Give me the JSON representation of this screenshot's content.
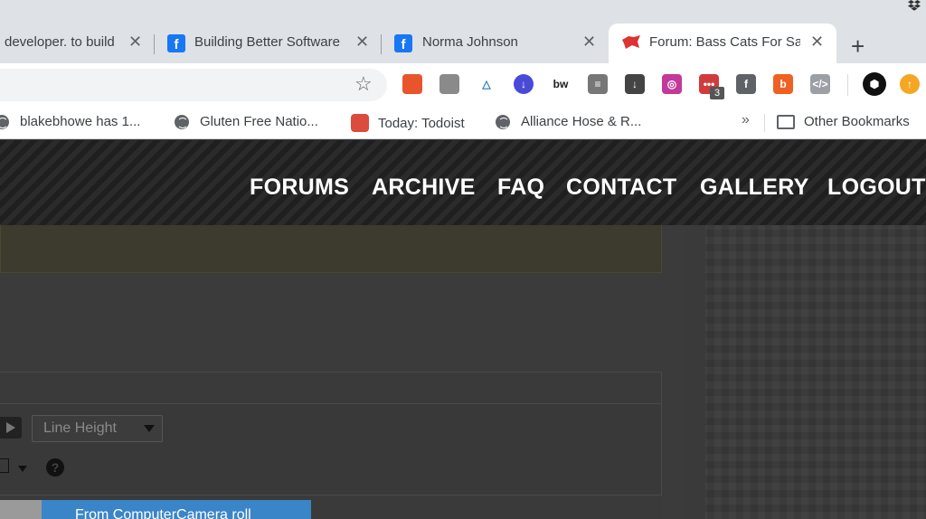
{
  "tabs": [
    {
      "label": "developer. to build"
    },
    {
      "label": "Building Better Software"
    },
    {
      "label": "Norma Johnson"
    },
    {
      "label": "Forum: Bass Cats For Sale"
    }
  ],
  "tab_close_glyph": "✕",
  "new_tab_glyph": "+",
  "toolbar": {
    "star_glyph": "☆",
    "extensions": [
      {
        "name": "fox-extension-icon",
        "color": "#e8542b",
        "text": ""
      },
      {
        "name": "gear-extension-icon",
        "color": "#8a8a8a",
        "text": ""
      },
      {
        "name": "triangle-extension-icon",
        "color": "#ffffff",
        "text": "△"
      },
      {
        "name": "download-circle-extension-icon",
        "color": "#4a4ad8",
        "text": "↓"
      },
      {
        "name": "bw-extension-icon",
        "color": "#ffffff",
        "text": "bw"
      },
      {
        "name": "stack-extension-icon",
        "color": "#777777",
        "text": "≡"
      },
      {
        "name": "download-box-extension-icon",
        "color": "#444444",
        "text": "↓"
      },
      {
        "name": "camera-ring-extension-icon",
        "color": "#c3399a",
        "text": "◎"
      },
      {
        "name": "notes-extension-icon",
        "color": "#d23b3b",
        "text": "•••"
      },
      {
        "name": "facebook-extension-icon",
        "color": "#5f6368",
        "text": "f"
      },
      {
        "name": "bitly-extension-icon",
        "color": "#ee6123",
        "text": "b"
      },
      {
        "name": "code-extension-icon",
        "color": "#9aa0a6",
        "text": "</>"
      },
      {
        "name": "geek-extension-icon",
        "color": "#111111",
        "text": "⬢"
      },
      {
        "name": "upload-extension-icon",
        "color": "#f5a623",
        "text": "↑"
      }
    ],
    "badge_count": "3"
  },
  "bookmarks": [
    {
      "label": "blakebhowe has 1..."
    },
    {
      "label": "Gluten Free Natio..."
    },
    {
      "label": "Today: Todoist"
    },
    {
      "label": "Alliance Hose & R..."
    }
  ],
  "bookmarks_more": "»",
  "other_bookmarks": "Other Bookmarks",
  "site_nav": [
    "FORUMS",
    "ARCHIVE",
    "FAQ",
    "CONTACT",
    "GALLERY",
    "LOGOUT"
  ],
  "editor": {
    "line_height_label": "Line Height",
    "help_glyph": "?",
    "upload_label": "From ComputerCamera roll"
  }
}
